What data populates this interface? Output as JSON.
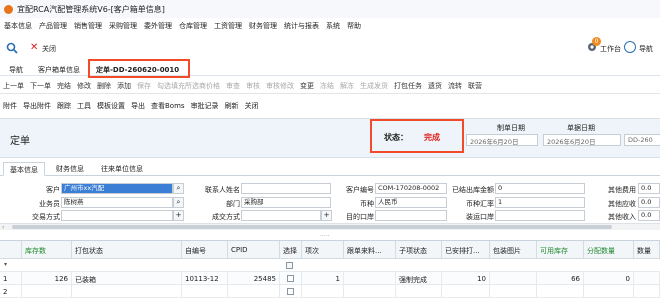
{
  "window": {
    "title": "宜配RCA汽配管理系统V6-[客户箱单信息]"
  },
  "menu": [
    "基本信息",
    "产品管理",
    "销售管理",
    "采购管理",
    "委外管理",
    "仓库管理",
    "工资管理",
    "财务管理",
    "统计与报表",
    "系统",
    "帮助"
  ],
  "toolbar": {
    "close_label": "关闭",
    "workbench_label": "工作台",
    "workbench_badge": "0",
    "nav_label": "导航"
  },
  "tabs": {
    "nav": "导航",
    "t1": "客户箱单信息",
    "t2": "定单-DD-260620-0010"
  },
  "navbar": {
    "items": [
      "上一单",
      "下一单",
      "完结",
      "修改",
      "删除",
      "添加",
      "保存",
      "勾选填充所选商价格",
      "审查",
      "审核",
      "审核修改",
      "变更",
      "冻结",
      "解冻",
      "生成发货",
      "打包任务",
      "遗货",
      "流转",
      "联营"
    ]
  },
  "attbar": {
    "items": [
      "附件",
      "导出附件",
      "跟踪",
      "工具",
      "模板设置",
      "导出",
      "查看Boms",
      "审批记录",
      "刷新",
      "关闭"
    ]
  },
  "header": {
    "doc_title": "定单",
    "status_label": "状态：",
    "status_value": "完成",
    "make_date_label": "制单日期",
    "make_date_value": "2026年6月20日",
    "bill_date_label": "单据日期",
    "bill_date_value": "2026年6月20日",
    "doc_no_value": "DD-260"
  },
  "subtabs": [
    "基本信息",
    "财务信息",
    "往来单位信息"
  ],
  "form": {
    "customer_label": "客户",
    "customer_value": "广州市xx汽配",
    "contact_label": "联系人姓名",
    "contact_value": "",
    "cust_no_label": "客户编号",
    "cust_no_value": "COM-170208-0002",
    "paid_label": "已结出库金额",
    "paid_value": "0",
    "other_fee_label": "其他费用",
    "other_fee_value": "0.0",
    "sales_label": "业务员",
    "sales_value": "陈树燕",
    "dept_label": "部门",
    "dept_value": "采购部",
    "currency_label": "币种",
    "currency_value": "人民币",
    "rate_label": "币种汇率",
    "rate_value": "1",
    "other_recv_label": "其他应收",
    "other_recv_value": "0.0",
    "trade_label": "交易方式",
    "deal_label": "成交方式",
    "dest_label": "目的口岸",
    "ship_label": "装运口岸",
    "other_in_label": "其他收入",
    "other_in_value": "0.0"
  },
  "grid": {
    "columns": [
      "库存数",
      "打包状态",
      "自编号",
      "CPID",
      "选择",
      "项次",
      "跟单来料...",
      "子项状态",
      "已安排打...",
      "包装图片",
      "可用库存",
      "分配数量",
      "数量"
    ],
    "rows": [
      {
        "idx": "1",
        "stock": "126",
        "pack": "已装箱",
        "code": "10113-12",
        "cpid": "25485",
        "item": "1",
        "sub": "强制完成",
        "arranged": "10",
        "avail": "66",
        "alloc": "0"
      },
      {
        "idx": "2",
        "stock": "",
        "pack": "",
        "code": "",
        "cpid": "",
        "item": "",
        "sub": "",
        "arranged": "",
        "avail": "",
        "alloc": ""
      }
    ]
  },
  "colors": {
    "accent": "#f24b2a",
    "green": "#1e8a2f",
    "status": "#e02020"
  }
}
